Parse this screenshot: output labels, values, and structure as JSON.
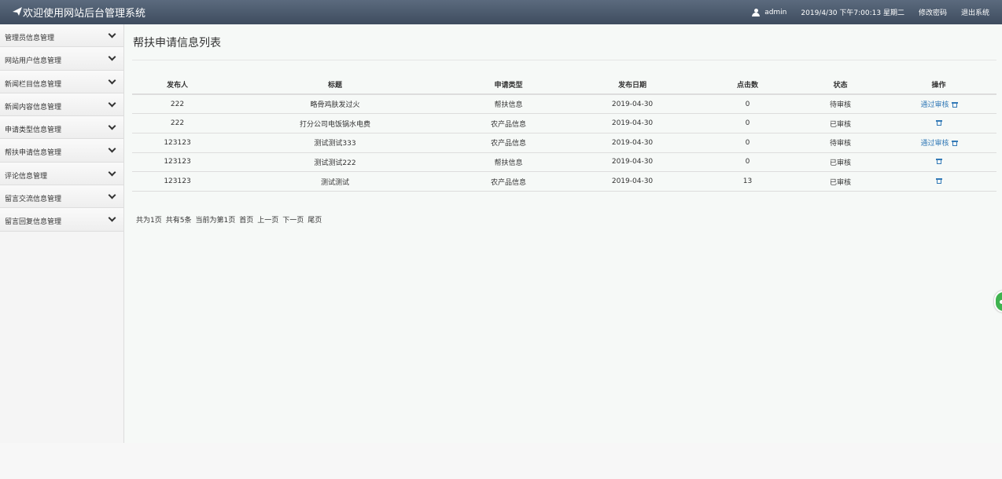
{
  "header": {
    "title": "欢迎使用网站后台管理系统",
    "user": "admin",
    "datetime": "2019/4/30 下午7:00:13 星期二",
    "change_password": "修改密码",
    "logout": "退出系统"
  },
  "sidebar": {
    "items": [
      {
        "label": "管理员信息管理"
      },
      {
        "label": "网站用户信息管理"
      },
      {
        "label": "新闻栏目信息管理"
      },
      {
        "label": "新闻内容信息管理"
      },
      {
        "label": "申请类型信息管理"
      },
      {
        "label": "帮扶申请信息管理"
      },
      {
        "label": "评论信息管理"
      },
      {
        "label": "留言交流信息管理"
      },
      {
        "label": "留言回复信息管理"
      }
    ]
  },
  "main": {
    "title": "帮扶申请信息列表",
    "columns": [
      "发布人",
      "标题",
      "申请类型",
      "发布日期",
      "点击数",
      "状态",
      "操作"
    ],
    "rows": [
      {
        "publisher": "222",
        "title": "略骨鸡肤发过火",
        "type": "帮扶信息",
        "date": "2019-04-30",
        "clicks": "0",
        "status": "待审核",
        "approve": "通过审核"
      },
      {
        "publisher": "222",
        "title": "打分公司电饭锅水电费",
        "type": "农产品信息",
        "date": "2019-04-30",
        "clicks": "0",
        "status": "已审核",
        "approve": ""
      },
      {
        "publisher": "123123",
        "title": "测试测试333",
        "type": "农产品信息",
        "date": "2019-04-30",
        "clicks": "0",
        "status": "待审核",
        "approve": "通过审核"
      },
      {
        "publisher": "123123",
        "title": "测试测试222",
        "type": "帮扶信息",
        "date": "2019-04-30",
        "clicks": "0",
        "status": "已审核",
        "approve": ""
      },
      {
        "publisher": "123123",
        "title": "测试测试",
        "type": "农产品信息",
        "date": "2019-04-30",
        "clicks": "13",
        "status": "已审核",
        "approve": ""
      }
    ],
    "pager": {
      "total_pages": "共为1页",
      "total_items": "共有5条",
      "current": "当前为第1页",
      "first": "首页",
      "prev": "上一页",
      "next": "下一页",
      "last": "尾页"
    }
  }
}
